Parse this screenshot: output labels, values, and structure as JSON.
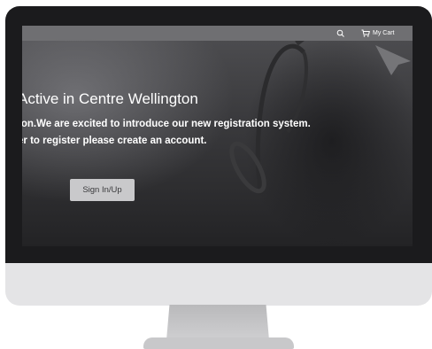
{
  "header": {
    "search_icon": "search-icon",
    "cart_icon": "cart-icon",
    "cart_label": "My Cart"
  },
  "hero": {
    "title": "Active in Centre Wellington",
    "line1": "ton.We are excited to introduce our new registration system.",
    "line2": "er to register please create an account.",
    "signin_label": "Sign In/Up"
  },
  "colors": {
    "bezel": "#1b1b1d",
    "chin": "#e4e4e6",
    "topbar": "#6f6f72",
    "button": "#c9c9cb"
  }
}
